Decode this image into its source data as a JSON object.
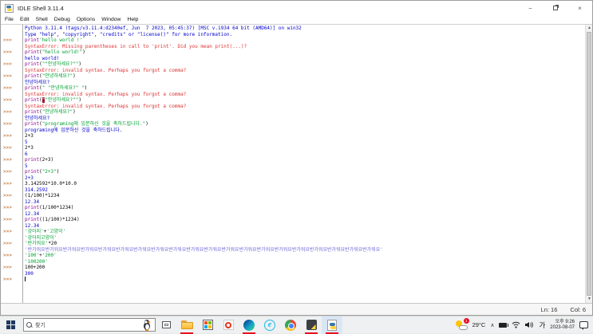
{
  "window": {
    "title": "IDLE Shell 3.11.4",
    "controls": {
      "minimize": "−",
      "close": "×"
    }
  },
  "menu": {
    "items": [
      "File",
      "Edit",
      "Shell",
      "Debug",
      "Options",
      "Window",
      "Help"
    ]
  },
  "shell": {
    "prompt": ">>>",
    "lines": [
      {
        "seg": [
          [
            "o",
            "Python 3.11.4 (tags/v3.11.4:d2340ef, Jun  7 2023, 05:45:37) [MSC v.1934 64 bit (AMD64)] on win32"
          ]
        ]
      },
      {
        "seg": [
          [
            "o",
            "Type \"help\", \"copyright\", \"credits\" or \"license()\" for more information."
          ]
        ]
      },
      {
        "p": 1,
        "seg": [
          [
            "b",
            "print"
          ],
          [
            "s",
            "'hello world !'"
          ]
        ]
      },
      {
        "seg": [
          [
            "e",
            "SyntaxError: Missing parentheses in call to 'print'. Did you mean print(...)?"
          ]
        ]
      },
      {
        "p": 1,
        "seg": [
          [
            "b",
            "print"
          ],
          [
            "c",
            "("
          ],
          [
            "s",
            "\"hello world!\""
          ],
          [
            "c",
            ")"
          ]
        ]
      },
      {
        "seg": [
          [
            "o",
            "hello world!"
          ]
        ]
      },
      {
        "p": 1,
        "seg": [
          [
            "b",
            "print"
          ],
          [
            "c",
            "("
          ],
          [
            "s",
            "\"\"안녕하세요?\"\""
          ],
          [
            "c",
            ")"
          ]
        ]
      },
      {
        "seg": [
          [
            "e",
            "SyntaxError: invalid syntax. Perhaps you forgot a comma?"
          ]
        ]
      },
      {
        "p": 1,
        "seg": [
          [
            "b",
            "print"
          ],
          [
            "c",
            "("
          ],
          [
            "s",
            "\"안녕하세요?\""
          ],
          [
            "c",
            ")"
          ]
        ]
      },
      {
        "seg": [
          [
            "o",
            "안녕하세요?"
          ]
        ]
      },
      {
        "p": 1,
        "seg": [
          [
            "b",
            "print"
          ],
          [
            "c",
            "("
          ],
          [
            "s",
            "\" \"안녕하세요?\" \""
          ],
          [
            "c",
            ")"
          ]
        ]
      },
      {
        "seg": [
          [
            "e",
            "SyntaxError: invalid syntax. Perhaps you forgot a comma?"
          ]
        ]
      },
      {
        "p": 1,
        "seg": [
          [
            "b",
            "print"
          ],
          [
            "c",
            "("
          ],
          [
            "h",
            "\""
          ],
          [
            "s",
            "\"안녕하세요?\"\""
          ],
          [
            "c",
            ")"
          ]
        ]
      },
      {
        "seg": [
          [
            "e",
            "SyntaxError: invalid syntax. Perhaps you forgot a comma?"
          ]
        ]
      },
      {
        "p": 1,
        "seg": [
          [
            "b",
            "print"
          ],
          [
            "c",
            "("
          ],
          [
            "s",
            "\"안녕하세요?\""
          ],
          [
            "c",
            ")"
          ]
        ]
      },
      {
        "seg": [
          [
            "o",
            "안녕하세요?"
          ]
        ]
      },
      {
        "p": 1,
        "seg": [
          [
            "b",
            "print"
          ],
          [
            "c",
            "("
          ],
          [
            "s",
            "\"programing에 입문하신 것을 축하드립니다.\""
          ],
          [
            "c",
            ")"
          ]
        ]
      },
      {
        "seg": [
          [
            "o",
            "programing에 입문하신 것을 축하드립니다."
          ]
        ]
      },
      {
        "p": 1,
        "seg": [
          [
            "c",
            "2+3"
          ]
        ]
      },
      {
        "seg": [
          [
            "o",
            "5"
          ]
        ]
      },
      {
        "p": 1,
        "seg": [
          [
            "c",
            "2*3"
          ]
        ]
      },
      {
        "seg": [
          [
            "o",
            "6"
          ]
        ]
      },
      {
        "p": 1,
        "seg": [
          [
            "b",
            "print"
          ],
          [
            "c",
            "(2+3)"
          ]
        ]
      },
      {
        "seg": [
          [
            "o",
            "5"
          ]
        ]
      },
      {
        "p": 1,
        "seg": [
          [
            "b",
            "print"
          ],
          [
            "c",
            "("
          ],
          [
            "s",
            "\"2+3\""
          ],
          [
            "c",
            ")"
          ]
        ]
      },
      {
        "seg": [
          [
            "o",
            "2+3"
          ]
        ]
      },
      {
        "p": 1,
        "seg": [
          [
            "c",
            "3.142592*10.0*10.0"
          ]
        ]
      },
      {
        "seg": [
          [
            "o",
            "314.2592"
          ]
        ]
      },
      {
        "p": 1,
        "seg": [
          [
            "c",
            "(1/100)*1234"
          ]
        ]
      },
      {
        "seg": [
          [
            "o",
            "12.34"
          ]
        ]
      },
      {
        "p": 1,
        "seg": [
          [
            "b",
            "print"
          ],
          [
            "c",
            "(1/100*1234)"
          ]
        ]
      },
      {
        "seg": [
          [
            "o",
            "12.34"
          ]
        ]
      },
      {
        "p": 1,
        "seg": [
          [
            "b",
            "print"
          ],
          [
            "c",
            "((1/100)*1234)"
          ]
        ]
      },
      {
        "seg": [
          [
            "o",
            "12.34"
          ]
        ]
      },
      {
        "p": 1,
        "seg": [
          [
            "s",
            "'강아지'"
          ],
          [
            "c",
            "+"
          ],
          [
            "s",
            "'고양이'"
          ]
        ]
      },
      {
        "seg": [
          [
            "g",
            "'강아지고양이'"
          ]
        ]
      },
      {
        "p": 1,
        "seg": [
          [
            "s",
            "'반가워요'"
          ],
          [
            "c",
            "*20"
          ]
        ]
      },
      {
        "seg": [
          [
            "l",
            "'반가워요반가워요반가워요반가워요반가워요반가워요반가워요반가워요반가워요반가워요반가워요반가워요반가워요반가워요반가워요반가워요반가워요반가워요반가워요반가워요'"
          ]
        ]
      },
      {
        "p": 1,
        "seg": [
          [
            "s",
            "'100'"
          ],
          [
            "c",
            "+"
          ],
          [
            "s",
            "'200'"
          ]
        ]
      },
      {
        "seg": [
          [
            "g",
            "'100200'"
          ]
        ]
      },
      {
        "p": 1,
        "seg": [
          [
            "c",
            "100+200"
          ]
        ]
      },
      {
        "seg": [
          [
            "o",
            "300"
          ]
        ]
      },
      {
        "p": 1,
        "cursor": 1,
        "seg": []
      }
    ]
  },
  "status": {
    "line": "Ln: 16",
    "col": "Col: 6"
  },
  "taskbar": {
    "search_placeholder": "찾기",
    "ie_glyph": "e",
    "weather_badge": "1",
    "temperature": "29°C",
    "chevron": "∧",
    "ime": "가",
    "time": "오후 9:26",
    "date": "2023-08-07"
  },
  "colors": {
    "stdout_blue": "#0000cd",
    "stderr_red": "#dd3333",
    "string_green": "#00a033",
    "builtin_purple": "#900090",
    "prompt_sienna": "#b45f1d",
    "running_indicator": "#e81123"
  }
}
